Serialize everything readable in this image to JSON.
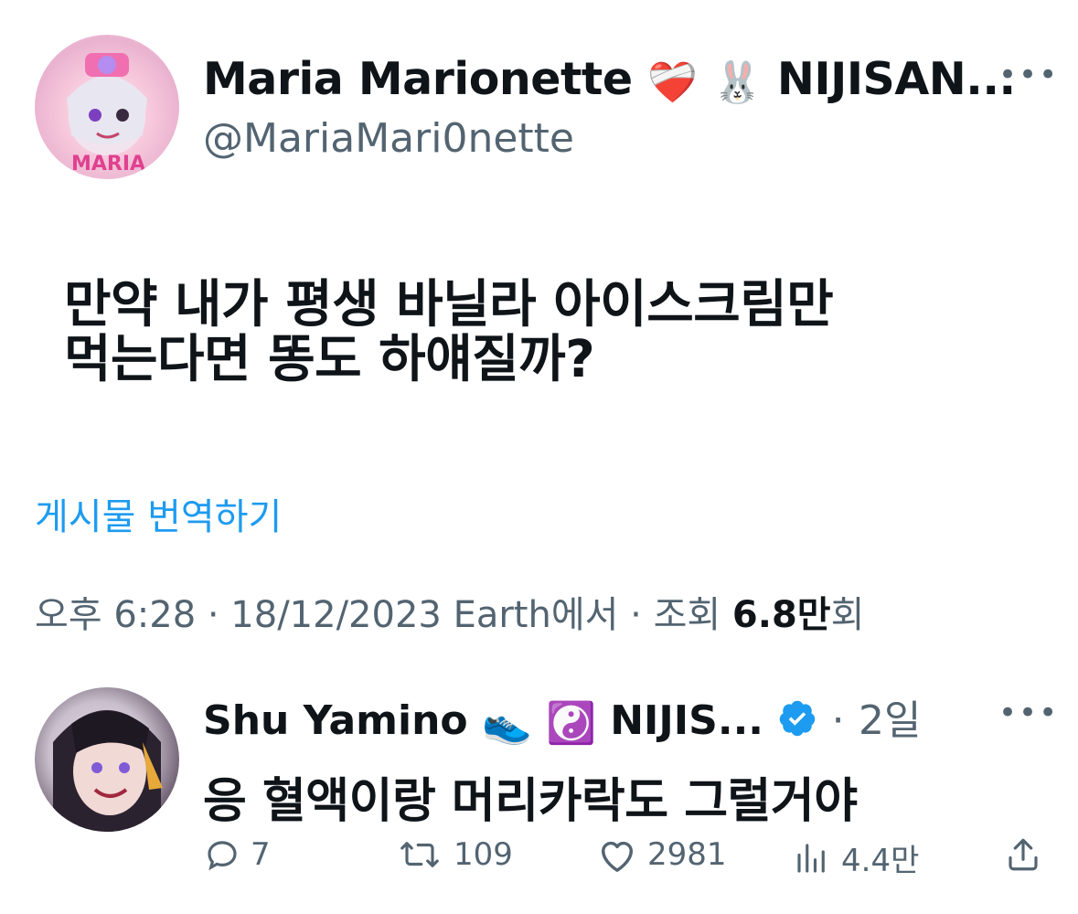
{
  "tweet": {
    "author_name": "Maria Marionette",
    "author_suffix": "NIJISAN...",
    "handle": "@MariaMari0nette",
    "text_line1": "만약 내가 평생 바닐라 아이스크림만",
    "text_line2": "먹는다면 똥도 하얘질까?",
    "translate_label": "게시물 번역하기",
    "time": "오후 6:28",
    "date": "18/12/2023",
    "source": "Earth에서",
    "views_label": "조회",
    "views_number": "6.8만",
    "views_suffix": "회"
  },
  "reply": {
    "author_name": "Shu Yamino",
    "author_suffix": "NIJIS...",
    "age": "2일",
    "text": "응 혈액이랑 머리카락도 그럴거야",
    "stats": {
      "replies": "7",
      "retweets": "109",
      "likes": "2981",
      "views": "4.4만"
    }
  },
  "colors": {
    "accent": "#1d9bf0",
    "secondary_text": "#536471",
    "primary_text": "#0f1419",
    "verified": "#1d9bf0"
  },
  "icons": [
    "more-icon",
    "heart-bandage-emoji",
    "rabbit-emoji",
    "shoe-emoji",
    "yin-yang-emoji",
    "verified-badge-icon",
    "reply-icon",
    "retweet-icon",
    "like-icon",
    "views-icon",
    "share-icon"
  ]
}
